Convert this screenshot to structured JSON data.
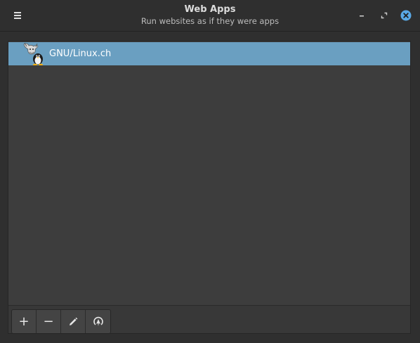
{
  "window": {
    "title": "Web Apps",
    "subtitle": "Run websites as if they were apps",
    "controls": {
      "menu_icon": "hamburger-menu-icon",
      "minimize_icon": "minimize-icon",
      "maximize_icon": "maximize-icon",
      "close_icon": "close-icon",
      "close_color": "#5aa9e6"
    }
  },
  "webapps": {
    "items": [
      {
        "label": "GNU/Linux.ch",
        "icon": "gnu-tux-icon",
        "selected": true
      }
    ],
    "selection_color": "#6a9fc1"
  },
  "toolbar": {
    "add_glyph": "+",
    "remove_glyph": "−",
    "edit_icon": "pencil-icon",
    "run_icon": "launch-icon"
  }
}
